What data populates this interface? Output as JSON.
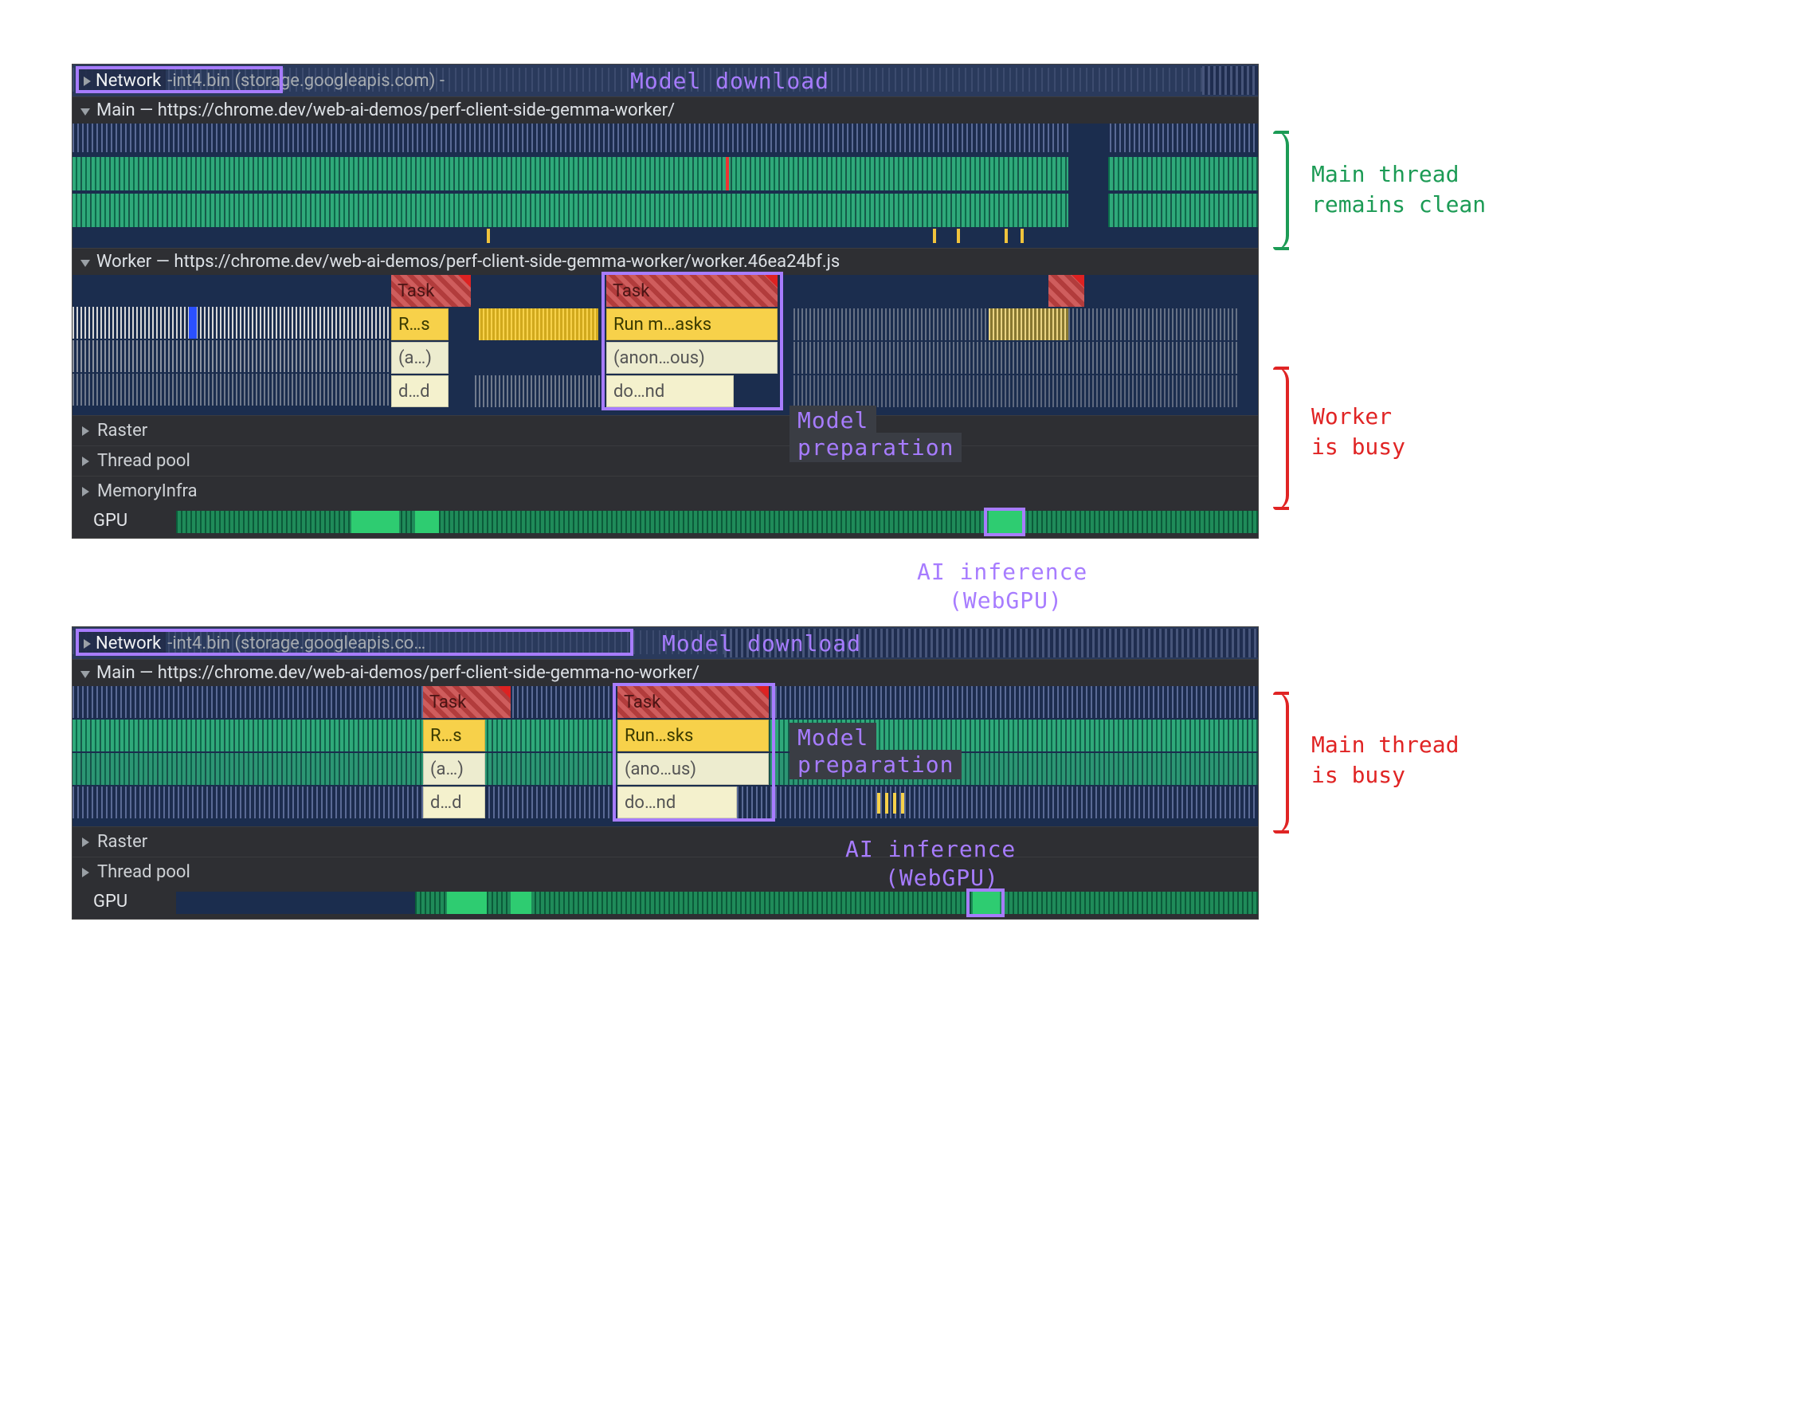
{
  "panel_top": {
    "network": {
      "label": "Network",
      "file": "-int4.bin (storage.googleapis.com) -"
    },
    "main_track": "Main — https://chrome.dev/web-ai-demos/perf-client-side-gemma-worker/",
    "worker_track": "Worker — https://chrome.dev/web-ai-demos/perf-client-side-gemma-worker/worker.46ea24bf.js",
    "worker_stack1": {
      "task": "Task",
      "row2": "R…s",
      "row3": "(a…)",
      "row4": "d…d"
    },
    "worker_stack2": {
      "task": "Task",
      "row2": "Run m…asks",
      "row3": "(anon…ous)",
      "row4": "do…nd"
    },
    "collapsed": [
      "Raster",
      "Thread pool",
      "MemoryInfra"
    ],
    "gpu_label": "GPU"
  },
  "panel_bottom": {
    "network": {
      "label": "Network",
      "file": "-int4.bin (storage.googleapis.co… "
    },
    "main_track": "Main — https://chrome.dev/web-ai-demos/perf-client-side-gemma-no-worker/",
    "main_stack1": {
      "task": "Task",
      "row2": "R…s",
      "row3": "(a…)",
      "row4": "d…d"
    },
    "main_stack2": {
      "task": "Task",
      "row2": "Run…sks",
      "row3": "(ano…us)",
      "row4": "do…nd"
    },
    "collapsed": [
      "Raster",
      "Thread pool"
    ],
    "gpu_label": "GPU"
  },
  "annotations": {
    "model_download": "Model download",
    "model_prep": "Model",
    "model_prep2": "preparation",
    "ai_inf1": "AI inference",
    "ai_inf2": "(WebGPU)",
    "main_clean1": "Main thread",
    "main_clean2": "remains clean",
    "worker_busy1": "Worker",
    "worker_busy2": "is busy",
    "main_busy1": "Main thread",
    "main_busy2": "is busy"
  }
}
